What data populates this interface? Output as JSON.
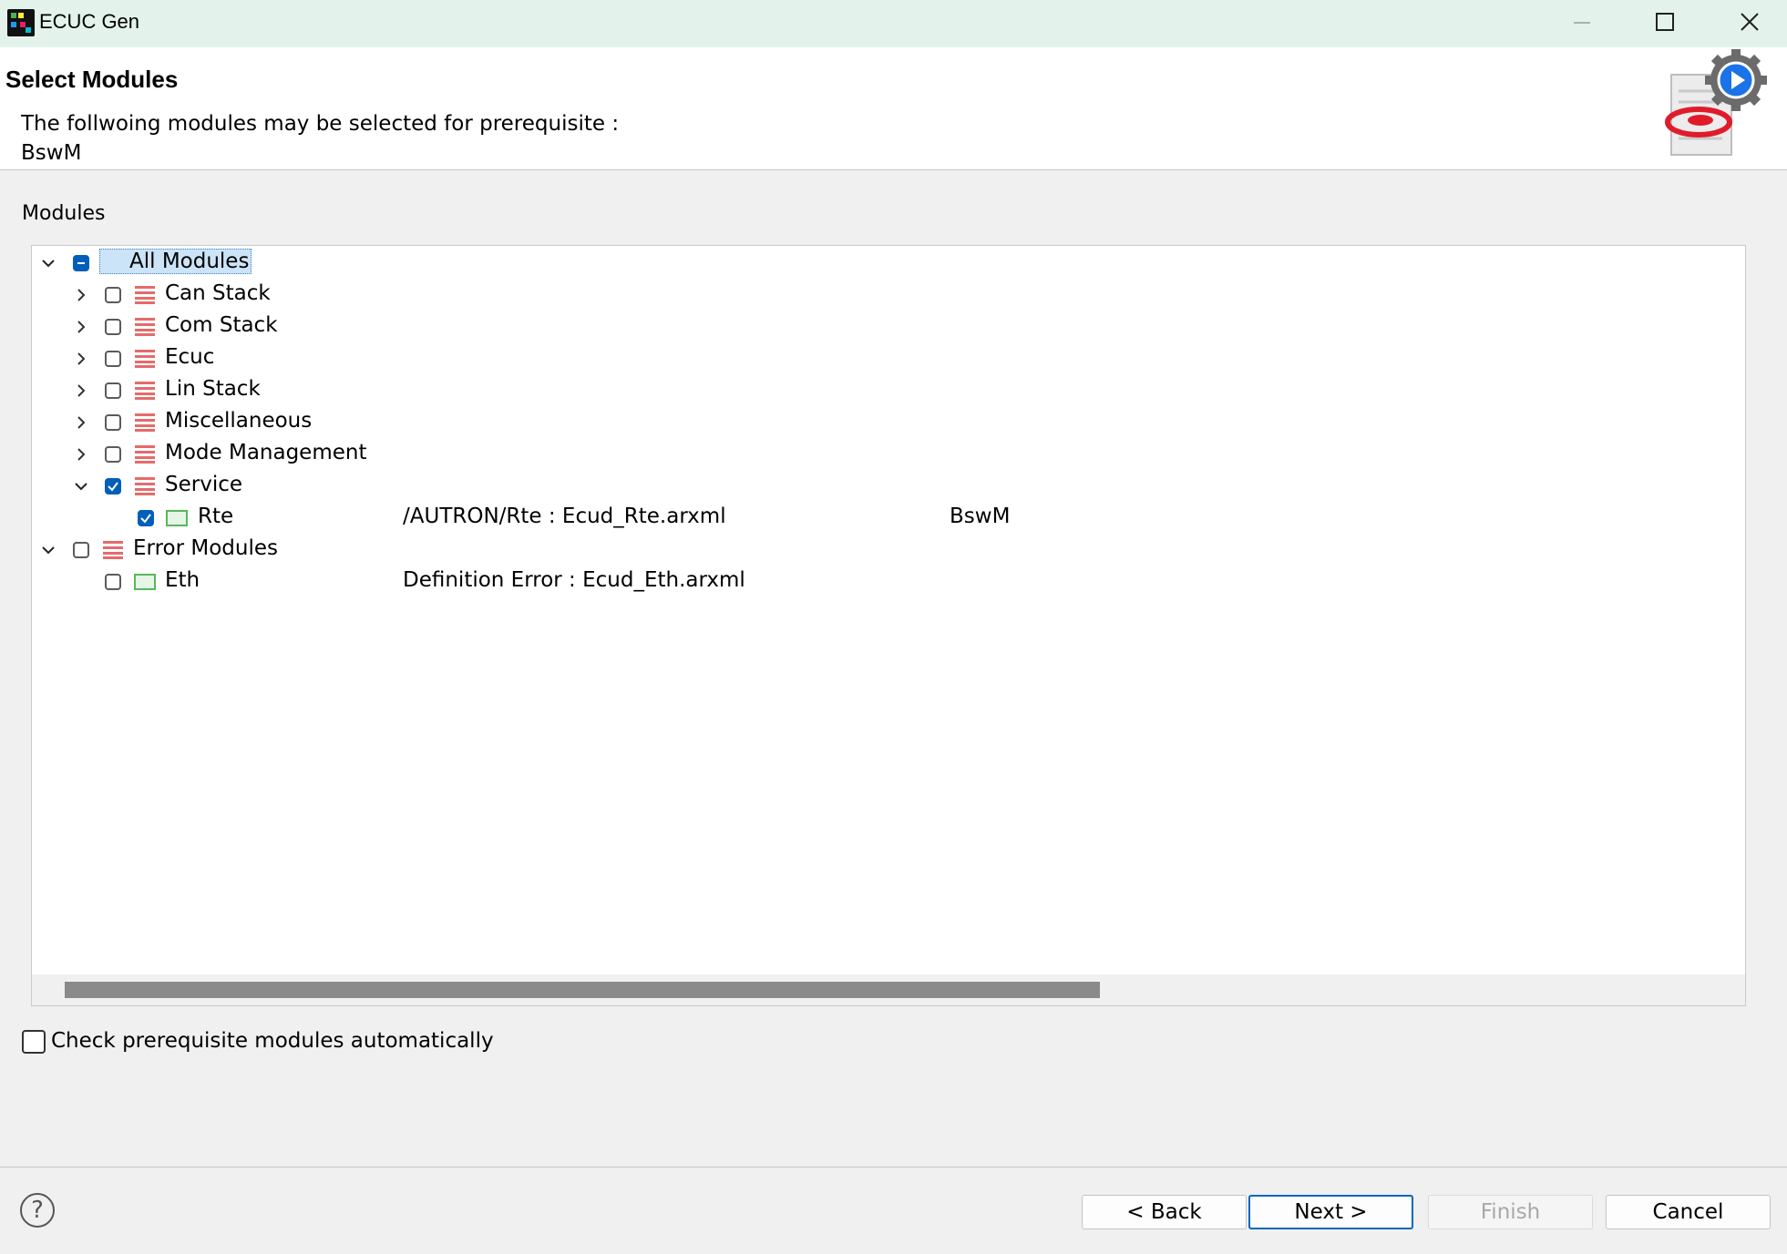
{
  "window": {
    "title": "ECUC Gen",
    "controls": {
      "minimize": "minimize",
      "maximize": "maximize",
      "close": "close"
    }
  },
  "header": {
    "title": "Select Modules",
    "description_line1": "The follwoing modules may be selected for prerequisite :",
    "description_line2": "BswM"
  },
  "modules": {
    "group_label": "Modules",
    "tree": [
      {
        "label": "All Modules",
        "expanded": true,
        "checkbox": "partial",
        "icon": "folder-icon",
        "selected": true
      },
      {
        "label": "Can Stack",
        "expanded": false,
        "checkbox": "unchecked",
        "icon": "folder-icon"
      },
      {
        "label": "Com Stack",
        "expanded": false,
        "checkbox": "unchecked",
        "icon": "folder-icon"
      },
      {
        "label": "Ecuc",
        "expanded": false,
        "checkbox": "unchecked",
        "icon": "folder-icon"
      },
      {
        "label": "Lin Stack",
        "expanded": false,
        "checkbox": "unchecked",
        "icon": "folder-icon"
      },
      {
        "label": "Miscellaneous",
        "expanded": false,
        "checkbox": "unchecked",
        "icon": "folder-icon"
      },
      {
        "label": "Mode Management",
        "expanded": false,
        "checkbox": "unchecked",
        "icon": "folder-icon"
      },
      {
        "label": "Service",
        "expanded": true,
        "checkbox": "checked",
        "icon": "folder-icon"
      },
      {
        "label": "Rte",
        "checkbox": "checked",
        "icon": "module-icon",
        "path": "/AUTRON/Rte : Ecud_Rte.arxml",
        "required_by": "BswM"
      },
      {
        "label": "Error Modules",
        "expanded": true,
        "checkbox": "unchecked",
        "icon": "folder-icon"
      },
      {
        "label": "Eth",
        "checkbox": "unchecked",
        "icon": "module-icon",
        "path": "Definition Error : Ecud_Eth.arxml"
      }
    ]
  },
  "options": {
    "auto_check_label": "Check prerequisite modules automatically",
    "auto_check_checked": false
  },
  "buttons": {
    "help": "?",
    "back": "< Back",
    "next": "Next >",
    "finish": "Finish",
    "cancel": "Cancel"
  },
  "colors": {
    "title_bar": "#e3f3ec",
    "accent": "#005fb8",
    "folder_icon": "#e46b6b",
    "module_icon": "#58b858"
  }
}
